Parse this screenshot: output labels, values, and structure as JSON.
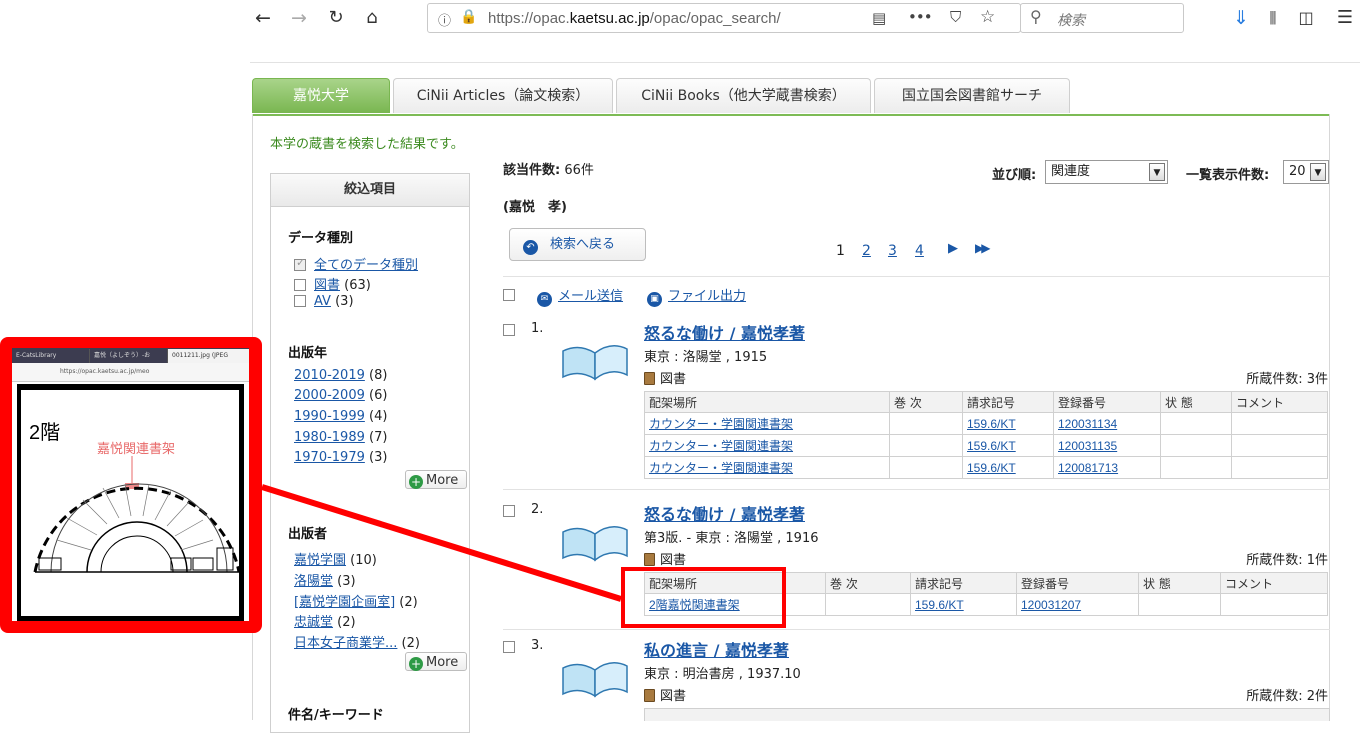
{
  "browser": {
    "url_prefix": "https://opac.",
    "url_domain": "kaetsu.ac.jp",
    "url_path": "/opac/opac_search/",
    "search_placeholder": "検索"
  },
  "tabs": [
    {
      "label": "嘉悦大学",
      "active": true
    },
    {
      "label": "CiNii Articles（論文検索）"
    },
    {
      "label": "CiNii Books（他大学蔵書検索）"
    },
    {
      "label": "国立国会図書館サーチ"
    }
  ],
  "intro": "本学の蔵書を検索した結果です。",
  "facets": {
    "header": "絞込項目",
    "data_type": {
      "title": "データ種別",
      "items": [
        {
          "label": "全てのデータ種別",
          "count": ""
        },
        {
          "label": "図書",
          "count": "(63)"
        },
        {
          "label": "AV",
          "count": "(3)"
        }
      ]
    },
    "year": {
      "title": "出版年",
      "items": [
        {
          "label": "2010-2019",
          "count": "(8)"
        },
        {
          "label": "2000-2009",
          "count": "(6)"
        },
        {
          "label": "1990-1999",
          "count": "(4)"
        },
        {
          "label": "1980-1989",
          "count": "(7)"
        },
        {
          "label": "1970-1979",
          "count": "(3)"
        }
      ],
      "more": "More"
    },
    "publisher": {
      "title": "出版者",
      "items": [
        {
          "label": "嘉悦学園",
          "count": "(10)"
        },
        {
          "label": "洛陽堂",
          "count": "(3)"
        },
        {
          "label": "[嘉悦学園企画室]",
          "count": "(2)"
        },
        {
          "label": "忠誠堂",
          "count": "(2)"
        },
        {
          "label": "日本女子商業学...",
          "count": "(2)"
        }
      ],
      "more": "More"
    },
    "keyword": {
      "title": "件名/キーワード"
    }
  },
  "results": {
    "hit_label": "該当件数:",
    "hit_count": "66件",
    "query": "(嘉悦　孝)",
    "sort_label": "並び順:",
    "sort_value": "関連度",
    "per_page_label": "一覧表示件数:",
    "per_page_value": "20",
    "back_button": "検索へ戻る",
    "pages": [
      "1",
      "2",
      "3",
      "4"
    ],
    "next_icon": "▶",
    "last_icon": "▶▶",
    "mail_label": "メール送信",
    "file_label": "ファイル出力",
    "holdings_headers": [
      "配架場所",
      "巻 次",
      "請求記号",
      "登録番号",
      "状 態",
      "コメント"
    ],
    "records": [
      {
        "num": "1.",
        "title": "怒るな働け / 嘉悦孝著",
        "pub": "東京 : 洛陽堂 , 1915",
        "type": "図書",
        "count": "所蔵件数: 3件",
        "holdings": [
          {
            "loc": "カウンター・学園関連書架",
            "vol": "",
            "call": "159.6/KT",
            "reg": "120031134",
            "status": "",
            "comment": ""
          },
          {
            "loc": "カウンター・学園関連書架",
            "vol": "",
            "call": "159.6/KT",
            "reg": "120031135",
            "status": "",
            "comment": ""
          },
          {
            "loc": "カウンター・学園関連書架",
            "vol": "",
            "call": "159.6/KT",
            "reg": "120081713",
            "status": "",
            "comment": ""
          }
        ]
      },
      {
        "num": "2.",
        "title": "怒るな働け / 嘉悦孝著",
        "pub": "第3版. - 東京 : 洛陽堂 , 1916",
        "type": "図書",
        "count": "所蔵件数: 1件",
        "holdings": [
          {
            "loc": "2階嘉悦関連書架",
            "vol": "",
            "call": "159.6/KT",
            "reg": "120031207",
            "status": "",
            "comment": ""
          }
        ]
      },
      {
        "num": "3.",
        "title": "私の進言 / 嘉悦孝著",
        "pub": "東京 : 明治書房 , 1937.10",
        "type": "図書",
        "count": "所蔵件数: 2件"
      }
    ]
  },
  "callout": {
    "floor": "2階",
    "shelf_label": "嘉悦関連書架",
    "mini_tabs": [
      "E-CatsLibrary",
      "嘉悦（よしぞう）-お",
      "0011211.jpg (JPEG"
    ],
    "mini_url": "https://opac.kaetsu.ac.jp/meo",
    "accent": "#ff0000"
  }
}
